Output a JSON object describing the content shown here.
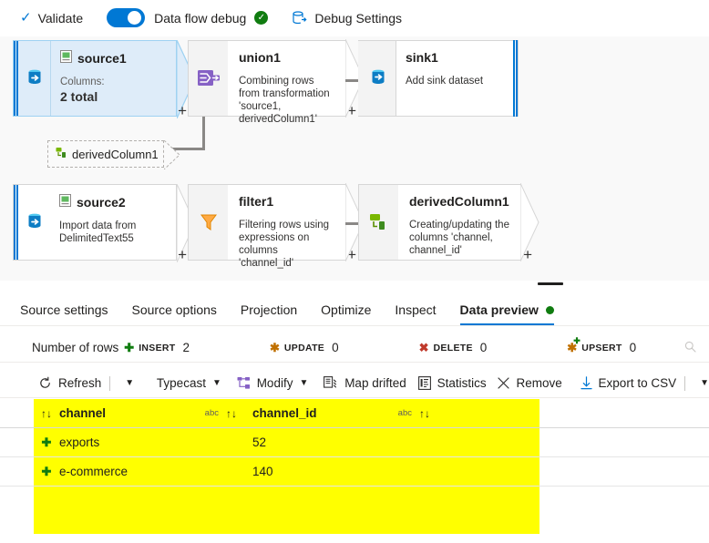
{
  "topbar": {
    "validate": "Validate",
    "validate_icon": "checkmark-icon",
    "debug_toggle_label": "Data flow debug",
    "debug_status_icon": "green-check-icon",
    "debug_settings": "Debug Settings",
    "debug_settings_icon": "debug-settings-icon",
    "accent": "#0078d4",
    "success": "#107c10"
  },
  "canvas": {
    "nodes": [
      {
        "name": "source1",
        "type": "source",
        "icon": "dataset-icon",
        "rail_icon": "source-database-icon",
        "sub_label": "Columns:",
        "sub_value": "2 total",
        "selected": true
      },
      {
        "name": "union1",
        "type": "transform",
        "icon": "union-icon",
        "description": "Combining rows from transformation 'source1, derivedColumn1'"
      },
      {
        "name": "sink1",
        "type": "sink",
        "rail_icon": "sink-database-icon",
        "description": "Add sink dataset"
      },
      {
        "name": "source2",
        "type": "source",
        "icon": "dataset-icon",
        "rail_icon": "source-database-icon",
        "description": "Import data from DelimitedText55",
        "selected": false
      },
      {
        "name": "filter1",
        "type": "transform",
        "icon": "filter-funnel-icon",
        "description": "Filtering rows using expressions on columns 'channel_id'"
      },
      {
        "name": "derivedColumn1",
        "type": "transform",
        "icon": "derived-column-icon",
        "description": "Creating/updating the columns 'channel, channel_id'"
      }
    ],
    "reference": {
      "label": "derivedColumn1",
      "icon": "derived-column-icon"
    },
    "add_label": "+"
  },
  "panel": {
    "tabs": [
      {
        "label": "Source settings",
        "active": false
      },
      {
        "label": "Source options",
        "active": false
      },
      {
        "label": "Projection",
        "active": false
      },
      {
        "label": "Optimize",
        "active": false
      },
      {
        "label": "Inspect",
        "active": false
      },
      {
        "label": "Data preview",
        "active": true,
        "status_dot": "#107c10"
      }
    ],
    "stats": {
      "label": "Number of rows",
      "items": [
        {
          "key": "INSERT",
          "value": "2",
          "icon": "plus-icon",
          "color": "#107c10"
        },
        {
          "key": "UPDATE",
          "value": "0",
          "icon": "asterisk-icon",
          "color": "#c07000"
        },
        {
          "key": "DELETE",
          "value": "0",
          "icon": "cross-icon",
          "color": "#c0392b"
        },
        {
          "key": "UPSERT",
          "value": "0",
          "icon": "asterisk-plus-icon",
          "color": "#c07000"
        }
      ],
      "search_icon": "search-icon"
    },
    "actions": [
      {
        "label": "Refresh",
        "icon": "refresh-icon",
        "has_caret": false,
        "has_sep": true
      },
      {
        "label": "",
        "icon": "",
        "has_caret": true,
        "caret_only": true
      },
      {
        "label": "Typecast",
        "icon": "",
        "has_caret": true
      },
      {
        "label": "Modify",
        "icon": "modify-icon",
        "has_caret": true
      },
      {
        "label": "Map drifted",
        "icon": "map-drifted-icon",
        "has_caret": false
      },
      {
        "label": "Statistics",
        "icon": "statistics-icon",
        "has_caret": false
      },
      {
        "label": "Remove",
        "icon": "close-x-icon",
        "has_caret": false
      },
      {
        "label": "Export to CSV",
        "icon": "download-icon",
        "has_caret": false,
        "has_sep_after": true
      },
      {
        "label": "",
        "icon": "",
        "has_caret": true,
        "caret_only": true
      }
    ],
    "grid": {
      "highlight_color": "#ffff00",
      "sort_icon": "sort-updown-icon",
      "type_icon": "abc",
      "columns": [
        {
          "name": "channel",
          "type_label": "abc"
        },
        {
          "name": "channel_id",
          "type_label": "abc"
        }
      ],
      "rows": [
        {
          "marker": "insert-plus-icon",
          "channel": "exports",
          "channel_id": "52"
        },
        {
          "marker": "insert-plus-icon",
          "channel": "e-commerce",
          "channel_id": "140"
        }
      ]
    }
  }
}
